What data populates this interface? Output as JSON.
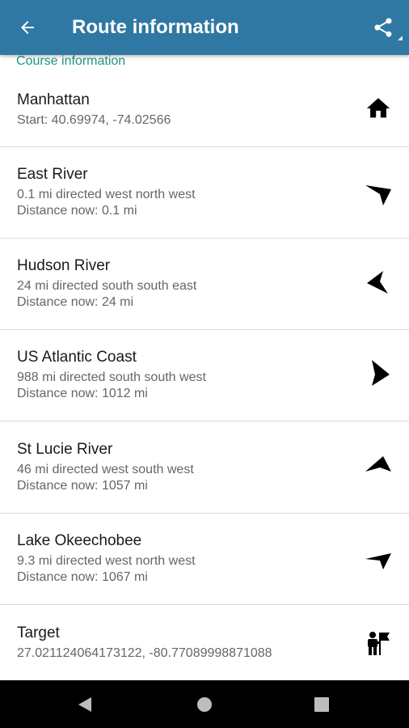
{
  "app_bar": {
    "title": "Route information",
    "back_icon": "arrow-back-icon",
    "share_icon": "share-icon",
    "background_color": "#2f78a3"
  },
  "section": {
    "header": "Course information",
    "header_color": "#1e9585"
  },
  "items": [
    {
      "title": "Manhattan",
      "line1": "Start: 40.69974, -74.02566",
      "line2": "",
      "icon": "home-icon"
    },
    {
      "title": "East River",
      "line1": "0.1 mi directed west north west",
      "line2": "Distance now: 0.1 mi",
      "icon": "direction-arrow-icon"
    },
    {
      "title": "Hudson River",
      "line1": "24 mi directed south south east",
      "line2": "Distance now: 24 mi",
      "icon": "direction-arrow-icon"
    },
    {
      "title": "US Atlantic Coast",
      "line1": "988 mi directed south south west",
      "line2": "Distance now: 1012 mi",
      "icon": "direction-arrow-icon"
    },
    {
      "title": "St Lucie River",
      "line1": "46 mi directed west south west",
      "line2": "Distance now: 1057 mi",
      "icon": "direction-arrow-icon"
    },
    {
      "title": "Lake Okeechobee",
      "line1": "9.3 mi directed west north west",
      "line2": "Distance now: 1067 mi",
      "icon": "direction-arrow-icon"
    },
    {
      "title": "Target",
      "line1": "27.021124064173122, -80.77089998871088",
      "line2": "",
      "icon": "target-flag-person-icon"
    }
  ],
  "nav_bar": {
    "back_icon": "nav-back-triangle-icon",
    "home_icon": "nav-home-circle-icon",
    "recents_icon": "nav-recents-square-icon"
  }
}
